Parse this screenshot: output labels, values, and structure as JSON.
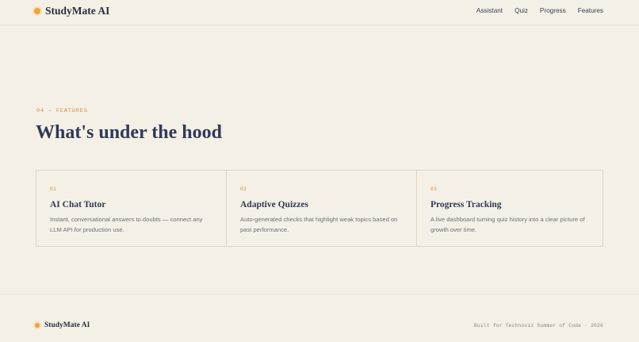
{
  "header": {
    "brand_name": "StudyMate AI",
    "nav": [
      "Assistant",
      "Quiz",
      "Progress",
      "Features"
    ]
  },
  "features": {
    "eyebrow": "04 — FEATURES",
    "title": "What's under the hood",
    "cards": [
      {
        "number": "01",
        "title": "AI Chat Tutor",
        "description": "Instant, conversational answers to doubts — connect any LLM API for production use."
      },
      {
        "number": "02",
        "title": "Adaptive Quizzes",
        "description": "Auto-generated checks that highlight weak topics based on past performance."
      },
      {
        "number": "03",
        "title": "Progress Tracking",
        "description": "A live dashboard turning quiz history into a clear picture of growth over time."
      }
    ]
  },
  "footer": {
    "brand_name": "StudyMate AI",
    "note": "Built for Technoviz Summer of Code · 2026"
  },
  "colors": {
    "background": "#f5f0e6",
    "accent": "#d68a3a",
    "brand_dot": "#f2a33a",
    "heading": "#2f3a57"
  }
}
